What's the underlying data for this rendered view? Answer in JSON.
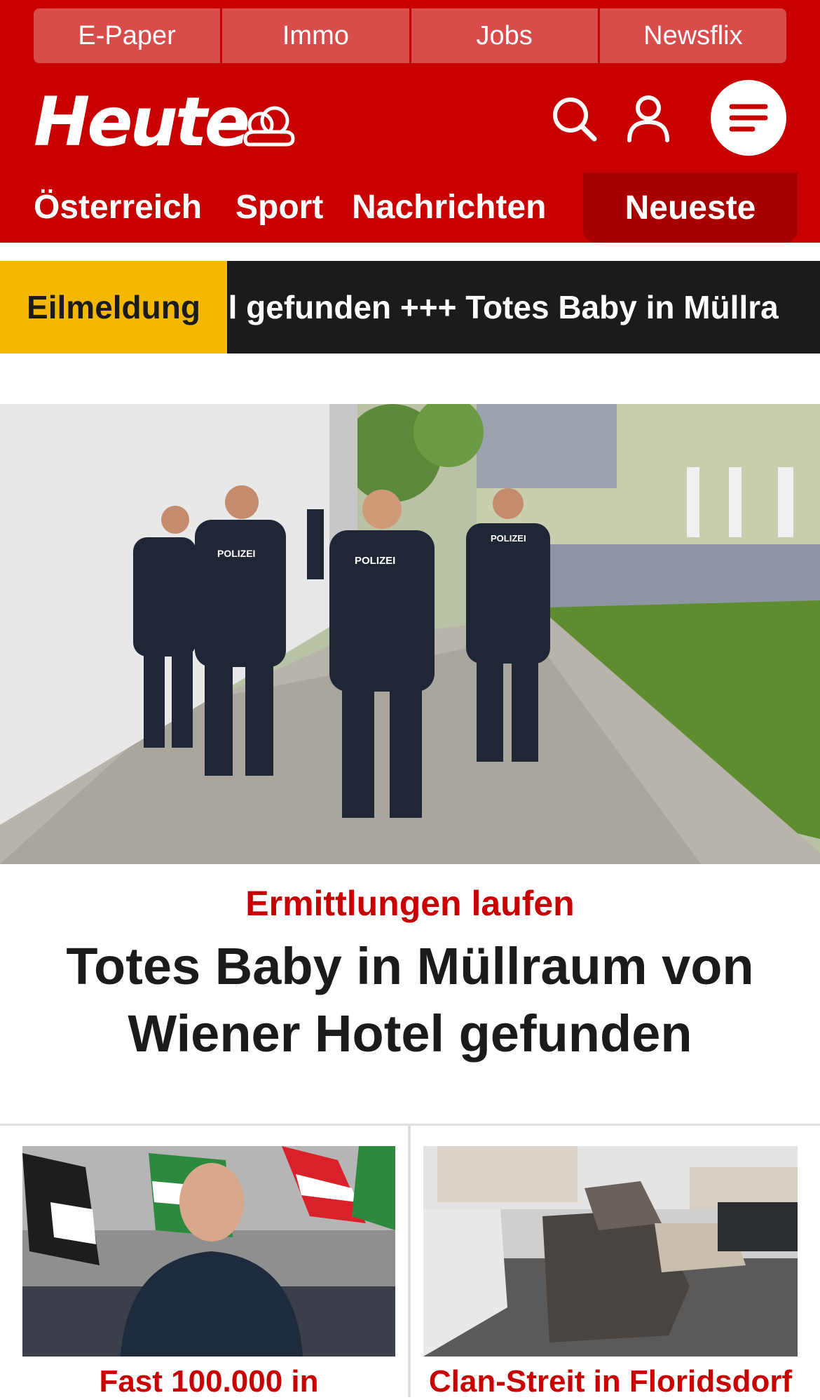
{
  "top_links": [
    "E-Paper",
    "Immo",
    "Jobs",
    "Newsflix"
  ],
  "logo": "Heute",
  "nav": {
    "items": [
      "Österreich",
      "Sport",
      "Nachrichten"
    ],
    "highlight": "Neueste"
  },
  "ticker": {
    "label": "Eilmeldung",
    "text": "el gefunden  +++  Totes Baby in Müllra"
  },
  "hero": {
    "kicker": "Ermittlungen laufen",
    "headline": "Totes Baby in Müllraum von Wiener Hotel gefunden",
    "vest_text_1": "POLIZEI",
    "vest_text_2": "POLIZEI",
    "vest_text_3": "POLIZEI"
  },
  "cards": [
    {
      "title": "Fast 100.000 in"
    },
    {
      "title": "Clan-Streit in Floridsdorf"
    }
  ],
  "colors": {
    "brand_red": "#c90000",
    "dark_red": "#a80000",
    "ticker_yellow": "#f5b800",
    "ticker_black": "#1b1b1b"
  },
  "icons": [
    "weather-cloud-icon",
    "search-icon",
    "user-icon",
    "menu-icon"
  ]
}
